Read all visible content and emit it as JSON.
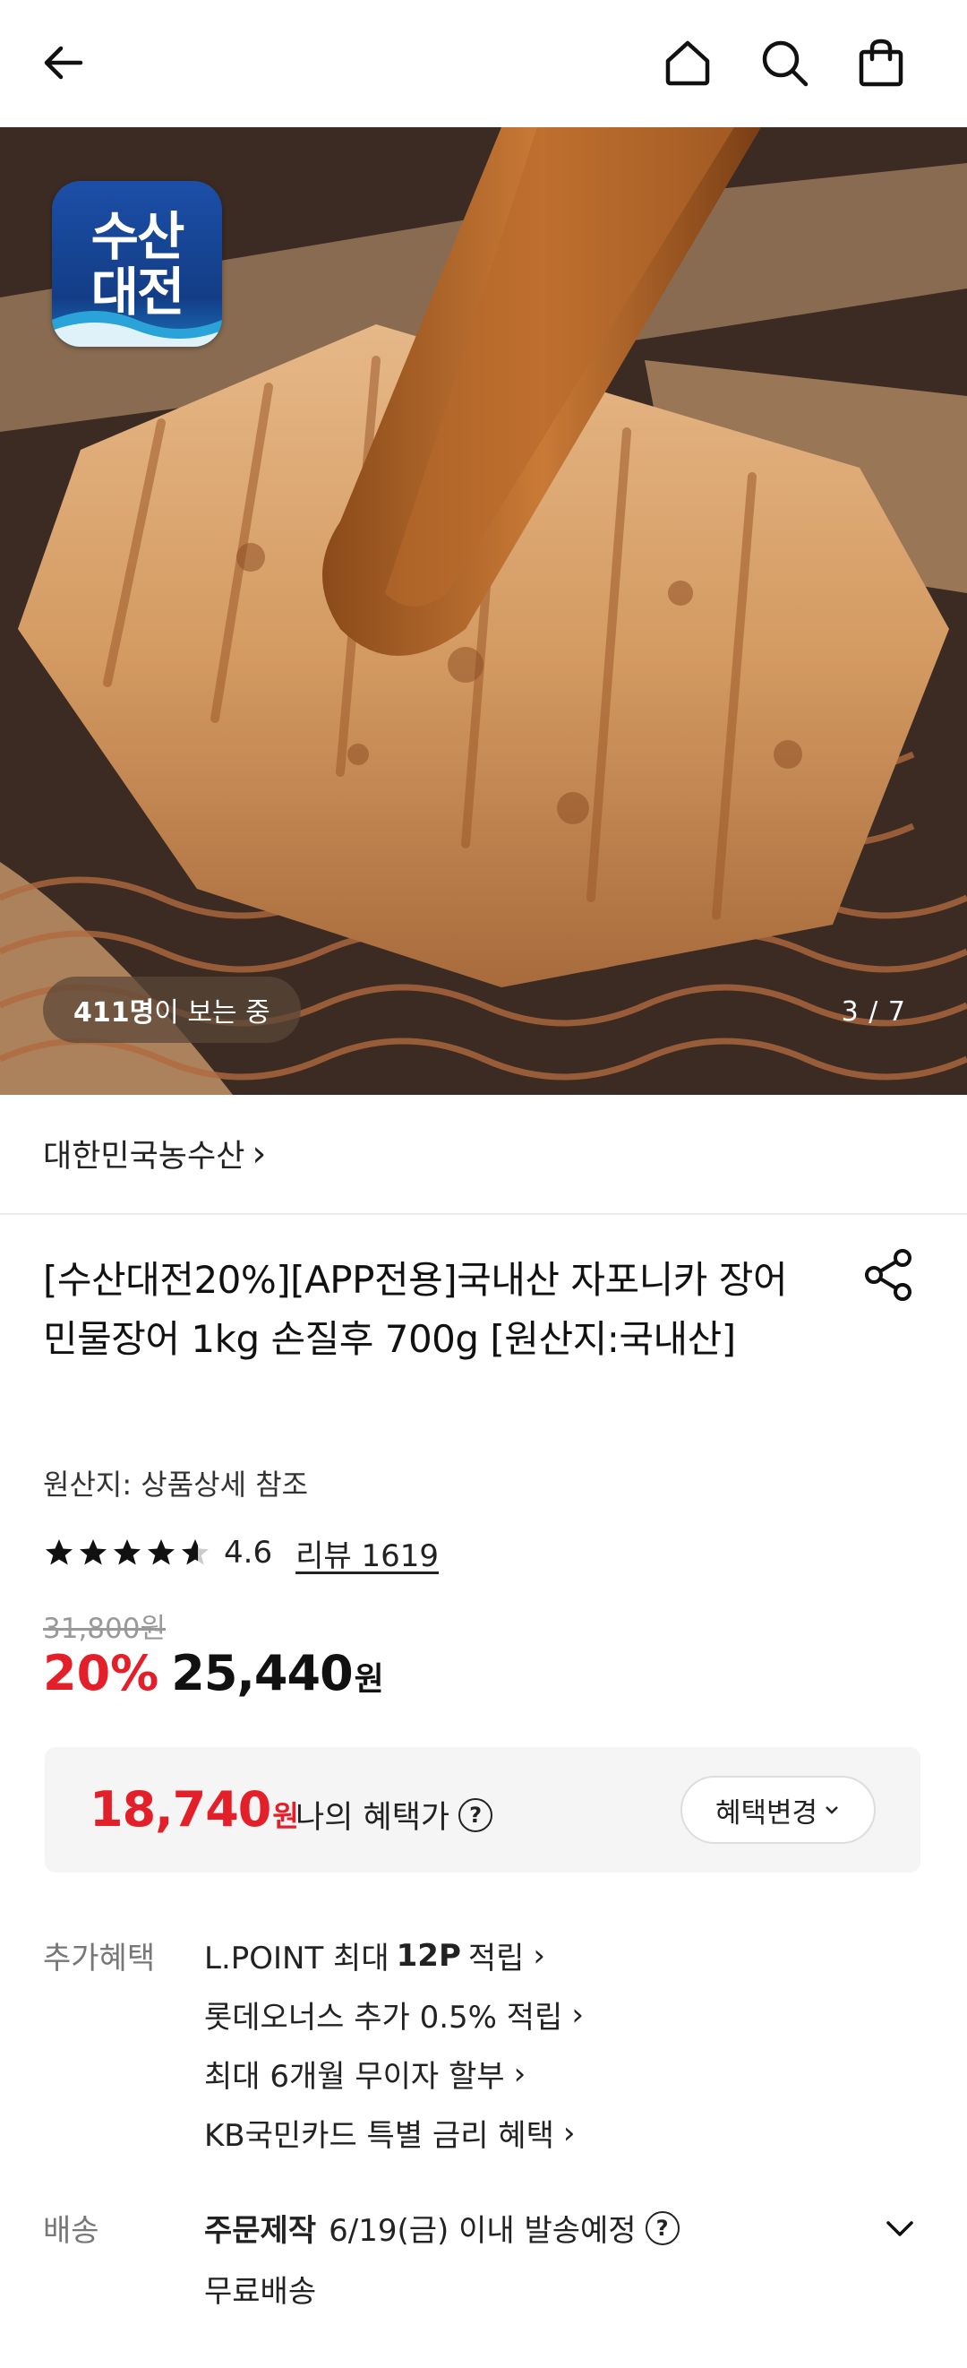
{
  "header": {
    "back_icon": "arrow-left-icon",
    "home_icon": "home-icon",
    "search_icon": "search-icon",
    "cart_icon": "shopping-bag-icon"
  },
  "hero": {
    "badge_line1": "수산",
    "badge_line2": "대전",
    "viewers_count": "411명",
    "viewers_text": "이 보는 중",
    "counter": "3 / 7"
  },
  "store": {
    "name": "대한민국농수산",
    "chevron": "›"
  },
  "product": {
    "title": "[수산대전20%][APP전용]국내산 자포니카 장어 민물장어 1kg 손질후 700g [원산지:국내산]",
    "origin": "원산지: 상품상세 참조",
    "rating": "4.6",
    "rating_value": 4.6,
    "review_label": "리뷰 1619",
    "original_price": "31,800원",
    "discount": "20%",
    "price": "25,440",
    "price_unit": "원"
  },
  "benefit_box": {
    "price": "18,740",
    "unit": "원",
    "label": "나의 혜택가",
    "help": "?",
    "change_button": "혜택변경"
  },
  "extra_benefits": {
    "label": "추가혜택",
    "items": [
      {
        "pre": "L.POINT 최대",
        "bold": "12P",
        "post": "적립"
      },
      {
        "pre": "롯데오너스 추가 0.5% 적립",
        "bold": "",
        "post": ""
      },
      {
        "pre": "최대 6개월 무이자 할부",
        "bold": "",
        "post": ""
      },
      {
        "pre": "KB국민카드 특별 금리 혜택",
        "bold": "",
        "post": ""
      }
    ],
    "chevron": "›"
  },
  "shipping": {
    "label": "배송",
    "type": "주문제작",
    "date": "6/19(금) 이내 발송예정",
    "help": "?",
    "fee": "무료배송"
  },
  "colors": {
    "accent_red": "#e3202a",
    "badge_blue": "#1c4fa8"
  }
}
